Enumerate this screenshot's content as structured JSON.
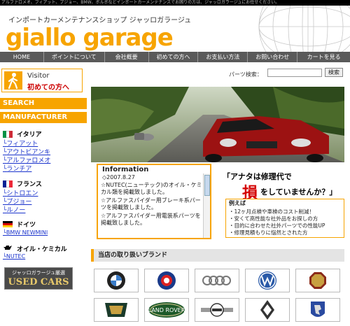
{
  "topbar_text": "アルファロメオ、フィアット、プジョー、BMW、ボルボなどインポートカーメンテナンスでお困りの方は、ジャッロガラージュにお任せください。",
  "header": {
    "tagline": "インポートカーメンテナンスショップ ジャッロガラージュ",
    "logo": "giallo garage"
  },
  "nav": [
    "HOME",
    "ポイントについて",
    "会社概要",
    "初めての方へ",
    "お支払い方法",
    "お問い合わせ",
    "カートを見る"
  ],
  "visitor": {
    "title": "Visitor",
    "subtitle": "初めての方へ"
  },
  "sidebar": {
    "search_header": "SEARCH",
    "manufacturer_header": "MANUFACTURER",
    "italy": {
      "label": "イタリア",
      "links": [
        "フィアット",
        "アウトビアンキ",
        "アルファロメオ",
        "ランチア"
      ]
    },
    "france": {
      "label": "フランス",
      "links": [
        "シトロエン",
        "プジョー",
        "ルノー"
      ]
    },
    "germany": {
      "label": "ドイツ",
      "links": [
        "BMW NEWMINI"
      ]
    },
    "oil": {
      "label": "オイル・ケミカル",
      "links": [
        "NUTEC"
      ]
    },
    "usedcars": {
      "top": "ジャッロガラージュ厳選",
      "bottom": "USED CARS"
    }
  },
  "search": {
    "label": "パーツ検索：",
    "button": "検索",
    "value": ""
  },
  "info": {
    "title": "Information",
    "date": "◇2007.8.27",
    "items": [
      "☆NUTEC(ニューテック)のオイル・ケミカル類を掲載致しました。",
      "☆アルファスパイダー用ブレーキ系パーツを掲載致しました。",
      "☆アルファスパイダー用電装系パーツを掲載致しました。"
    ]
  },
  "slogan": {
    "line1": "「アナタは修理代で",
    "big": "損",
    "line2": "をしていませんか？」",
    "example_label": "例えば",
    "examples": [
      "・12ヶ月点検や車検のコスト削減！",
      "・安くて高性能な社外品をお探しの方",
      "・目的に合わせた社外パーツでの性能UP",
      "・修理見積もりに悩然とされた方"
    ]
  },
  "brands": {
    "header": "当店の取り扱いブランド",
    "row1": [
      "bmw-logo-icon",
      "saab-logo-icon",
      "audi-logo-icon",
      "vw-logo-icon",
      "mg-logo-icon"
    ],
    "row2": [
      "rover-logo-icon",
      "landrover-logo-icon",
      "mini-logo-icon",
      "renault-logo-icon",
      "peugeot-logo-icon"
    ],
    "landrover_text": "LAND ROVER"
  },
  "colors": {
    "accent": "#f7a400",
    "nav": "#5a5a5a",
    "link": "#1a33cc",
    "alert": "#d40000"
  }
}
